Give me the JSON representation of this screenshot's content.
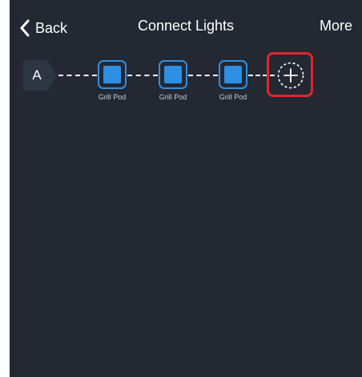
{
  "nav": {
    "back_label": "Back",
    "title": "Connect Lights",
    "more_label": "More"
  },
  "chain": {
    "port_label": "A",
    "devices": [
      {
        "label": "Grill Pod"
      },
      {
        "label": "Grill Pod"
      },
      {
        "label": "Grill Pod"
      }
    ],
    "add_icon": "add-circle-dashed-icon"
  },
  "colors": {
    "background": "#232833",
    "accent": "#2f8fe3",
    "highlight": "#e0262e",
    "text": "#ffffff"
  }
}
